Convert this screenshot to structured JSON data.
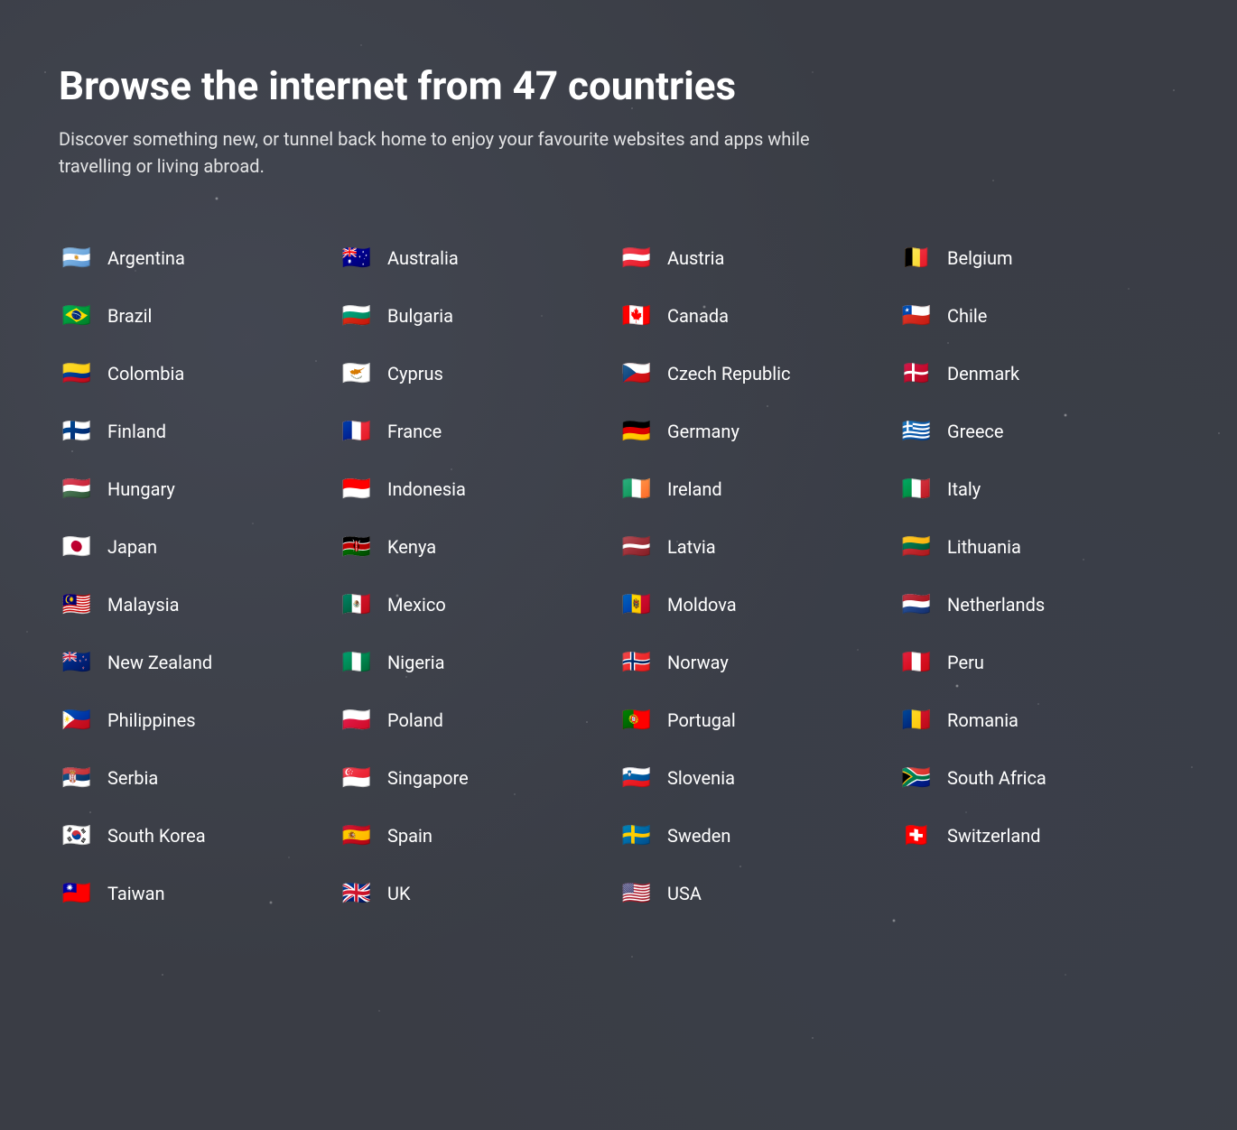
{
  "header": {
    "title": "Browse the internet from 47 countries",
    "subtitle": "Discover something new, or tunnel back home to enjoy your favourite websites and apps while travelling or living abroad."
  },
  "countries": [
    {
      "name": "Argentina",
      "flag": "🇦🇷"
    },
    {
      "name": "Australia",
      "flag": "🇦🇺"
    },
    {
      "name": "Austria",
      "flag": "🇦🇹"
    },
    {
      "name": "Belgium",
      "flag": "🇧🇪"
    },
    {
      "name": "Brazil",
      "flag": "🇧🇷"
    },
    {
      "name": "Bulgaria",
      "flag": "🇧🇬"
    },
    {
      "name": "Canada",
      "flag": "🇨🇦"
    },
    {
      "name": "Chile",
      "flag": "🇨🇱"
    },
    {
      "name": "Colombia",
      "flag": "🇨🇴"
    },
    {
      "name": "Cyprus",
      "flag": "🇨🇾"
    },
    {
      "name": "Czech Republic",
      "flag": "🇨🇿"
    },
    {
      "name": "Denmark",
      "flag": "🇩🇰"
    },
    {
      "name": "Finland",
      "flag": "🇫🇮"
    },
    {
      "name": "France",
      "flag": "🇫🇷"
    },
    {
      "name": "Germany",
      "flag": "🇩🇪"
    },
    {
      "name": "Greece",
      "flag": "🇬🇷"
    },
    {
      "name": "Hungary",
      "flag": "🇭🇺"
    },
    {
      "name": "Indonesia",
      "flag": "🇮🇩"
    },
    {
      "name": "Ireland",
      "flag": "🇮🇪"
    },
    {
      "name": "Italy",
      "flag": "🇮🇹"
    },
    {
      "name": "Japan",
      "flag": "🇯🇵"
    },
    {
      "name": "Kenya",
      "flag": "🇰🇪"
    },
    {
      "name": "Latvia",
      "flag": "🇱🇻"
    },
    {
      "name": "Lithuania",
      "flag": "🇱🇹"
    },
    {
      "name": "Malaysia",
      "flag": "🇲🇾"
    },
    {
      "name": "Mexico",
      "flag": "🇲🇽"
    },
    {
      "name": "Moldova",
      "flag": "🇲🇩"
    },
    {
      "name": "Netherlands",
      "flag": "🇳🇱"
    },
    {
      "name": "New Zealand",
      "flag": "🇳🇿"
    },
    {
      "name": "Nigeria",
      "flag": "🇳🇬"
    },
    {
      "name": "Norway",
      "flag": "🇳🇴"
    },
    {
      "name": "Peru",
      "flag": "🇵🇪"
    },
    {
      "name": "Philippines",
      "flag": "🇵🇭"
    },
    {
      "name": "Poland",
      "flag": "🇵🇱"
    },
    {
      "name": "Portugal",
      "flag": "🇵🇹"
    },
    {
      "name": "Romania",
      "flag": "🇷🇴"
    },
    {
      "name": "Serbia",
      "flag": "🇷🇸"
    },
    {
      "name": "Singapore",
      "flag": "🇸🇬"
    },
    {
      "name": "Slovenia",
      "flag": "🇸🇮"
    },
    {
      "name": "South Africa",
      "flag": "🇿🇦"
    },
    {
      "name": "South Korea",
      "flag": "🇰🇷"
    },
    {
      "name": "Spain",
      "flag": "🇪🇸"
    },
    {
      "name": "Sweden",
      "flag": "🇸🇪"
    },
    {
      "name": "Switzerland",
      "flag": "🇨🇭"
    },
    {
      "name": "Taiwan",
      "flag": "🇹🇼"
    },
    {
      "name": "UK",
      "flag": "🇬🇧"
    },
    {
      "name": "USA",
      "flag": "🇺🇸"
    }
  ]
}
